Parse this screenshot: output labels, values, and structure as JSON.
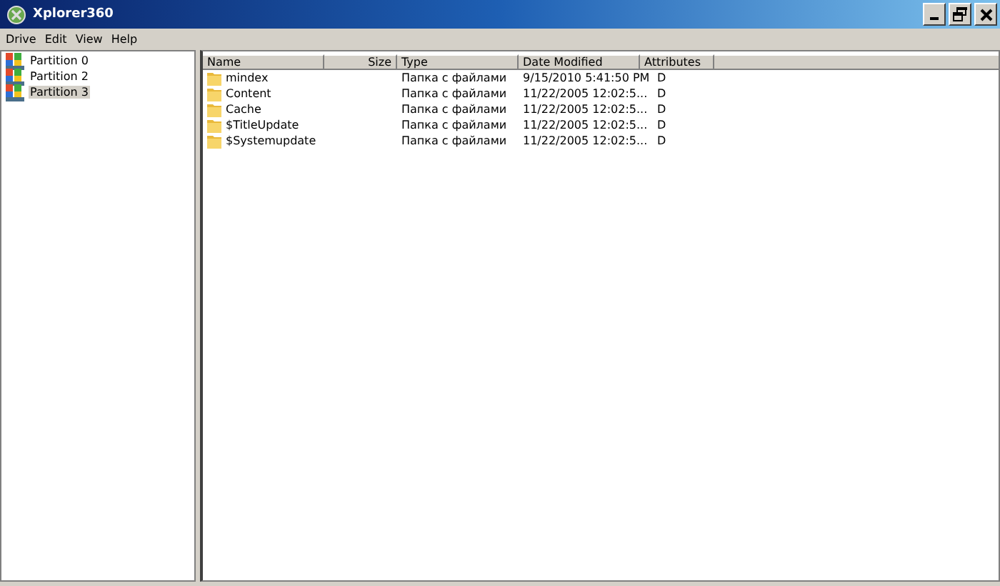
{
  "window": {
    "title": "Xplorer360"
  },
  "menu": [
    "Drive",
    "Edit",
    "View",
    "Help"
  ],
  "partitions": [
    {
      "label": "Partition 0",
      "selected": false
    },
    {
      "label": "Partition 2",
      "selected": false
    },
    {
      "label": "Partition 3",
      "selected": true
    }
  ],
  "table": {
    "columns": [
      "Name",
      "Size",
      "Type",
      "Date Modified",
      "Attributes"
    ],
    "rows": [
      [
        "mindex",
        "",
        "Папка с файлами",
        "9/15/2010 5:41:50 PM",
        "D"
      ],
      [
        "Content",
        "",
        "Папка с файлами",
        "11/22/2005 12:02:5...",
        "D"
      ],
      [
        "Cache",
        "",
        "Папка с файлами",
        "11/22/2005 12:02:5...",
        "D"
      ],
      [
        "$TitleUpdate",
        "",
        "Папка с файлами",
        "11/22/2005 12:02:5...",
        "D"
      ],
      [
        "$Systemupdate",
        "",
        "Папка с файлами",
        "11/22/2005 12:02:5...",
        "D"
      ]
    ]
  }
}
